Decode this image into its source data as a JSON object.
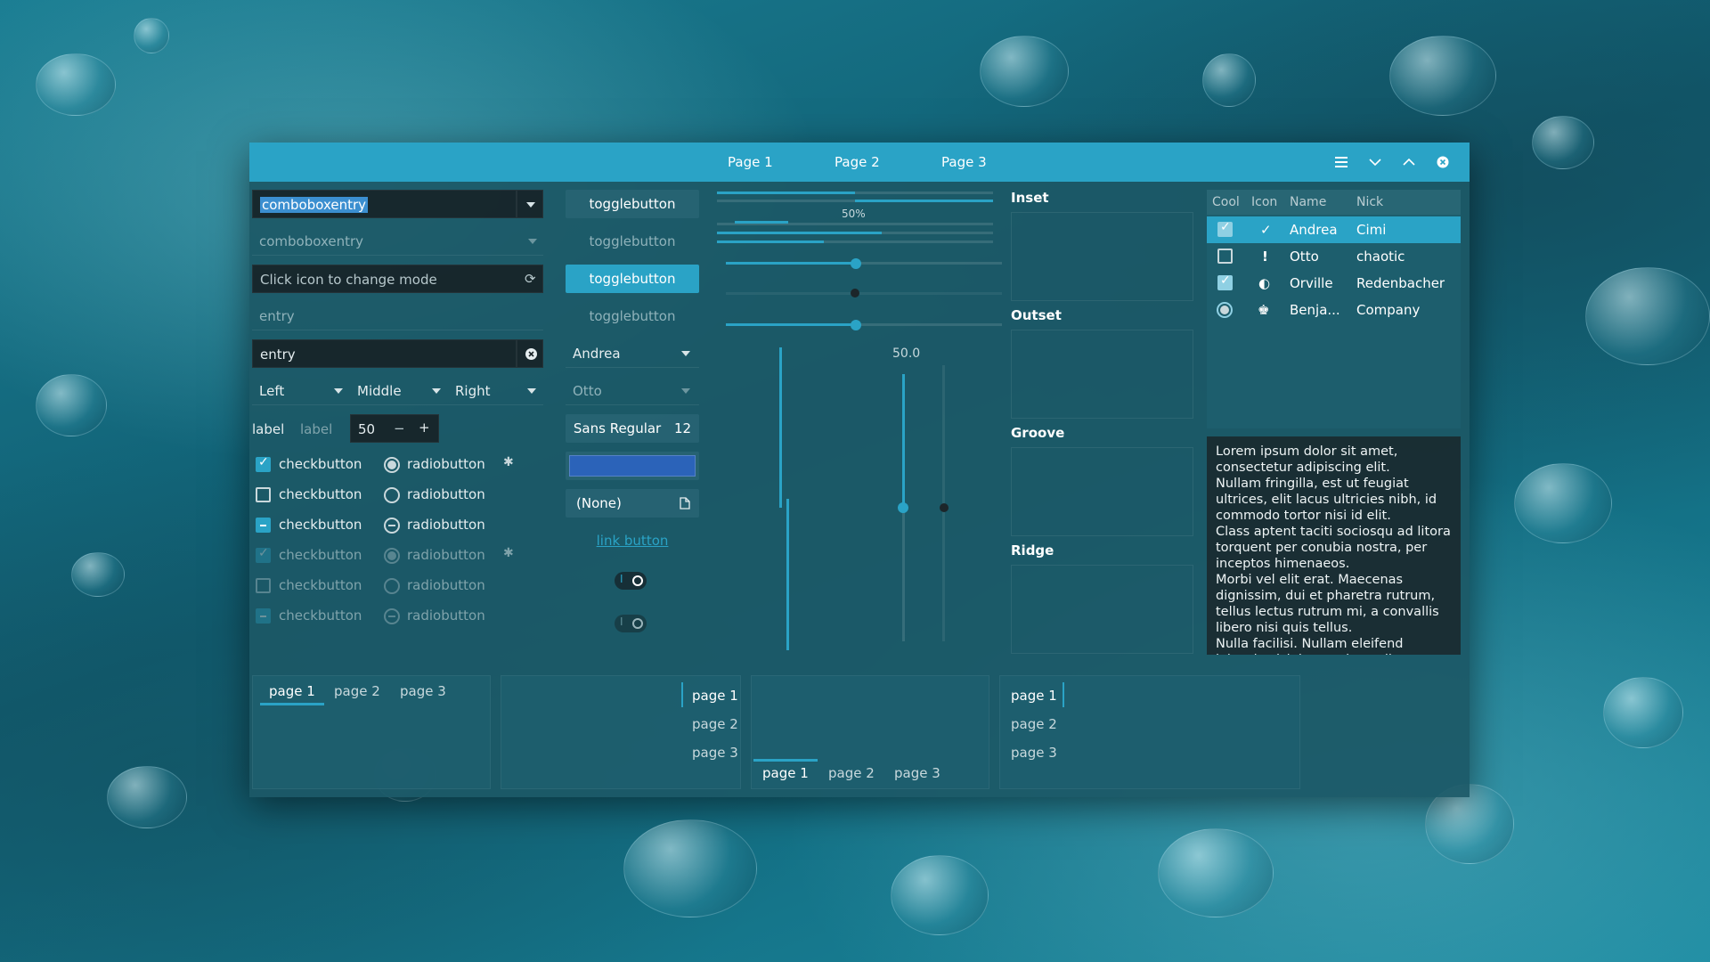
{
  "header": {
    "tabs": [
      "Page 1",
      "Page 2",
      "Page 3"
    ]
  },
  "col1": {
    "combo_active_value": "comboboxentry",
    "combo_inactive_value": "comboboxentry",
    "mode_entry_placeholder": "Click icon to change mode",
    "entry_placeholder": "entry",
    "entry_value": "entry",
    "align_left": "Left",
    "align_middle": "Middle",
    "align_right": "Right",
    "label1": "label",
    "label2": "label",
    "spin_value": "50",
    "spin_minus": "−",
    "spin_plus": "+",
    "check_label": "checkbutton",
    "radio_label": "radiobutton"
  },
  "col2": {
    "toggle_label": "togglebutton",
    "combo_andrea": "Andrea",
    "combo_otto": "Otto",
    "font_name": "Sans Regular",
    "font_size": "12",
    "file_chooser": "(None)",
    "link_label": "link button",
    "switch_on_glyph": "I"
  },
  "col3": {
    "progress_text": "50%",
    "progress_fraction": 0.5,
    "scale_value_label": "50.0",
    "scale_value": 50
  },
  "frames": {
    "inset": "Inset",
    "outset": "Outset",
    "groove": "Groove",
    "ridge": "Ridge"
  },
  "tree": {
    "columns": [
      "Cool",
      "Icon",
      "Name",
      "Nick"
    ],
    "rows": [
      {
        "cool": true,
        "icon": "checkmark-icon",
        "icon_glyph": "✓",
        "name": "Andrea",
        "nick": "Cimi",
        "selected": true
      },
      {
        "cool": false,
        "icon": "exclamation-icon",
        "icon_glyph": "!",
        "name": "Otto",
        "nick": "chaotic",
        "selected": false
      },
      {
        "cool": true,
        "icon": "half-moon-icon",
        "icon_glyph": "◐",
        "name": "Orville",
        "nick": "Redenbacher",
        "selected": false
      },
      {
        "cool": "radio",
        "icon": "person-icon",
        "icon_glyph": "♚",
        "name": "Benja...",
        "nick": "Company",
        "selected": false
      }
    ]
  },
  "textview": {
    "text": "Lorem ipsum dolor sit amet, consectetur adipiscing elit.\nNullam fringilla, est ut feugiat ultrices, elit lacus ultricies nibh, id commodo tortor nisi id elit.\nClass aptent taciti sociosqu ad litora torquent per conubia nostra, per inceptos himenaeos.\nMorbi vel elit erat. Maecenas dignissim, dui et pharetra rutrum, tellus lectus rutrum mi, a convallis libero nisi quis tellus.\nNulla facilisi. Nullam eleifend lobortis nisl, in porttitor tellus"
  },
  "notebooks": {
    "tabs": [
      "page 1",
      "page 2",
      "page 3"
    ]
  },
  "colors": {
    "accent": "#2aa3c6",
    "window_bg": "#1c5866",
    "entry_bg": "#161e22"
  }
}
